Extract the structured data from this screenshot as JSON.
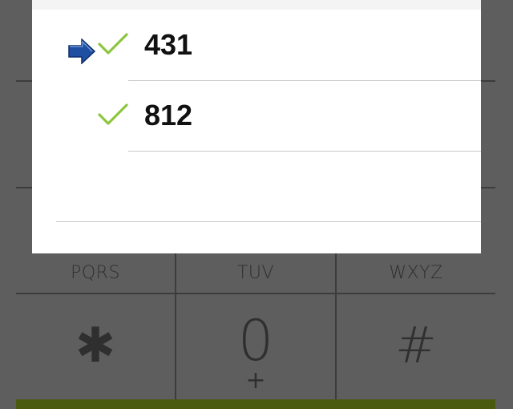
{
  "dialog": {
    "rows": [
      {
        "number": "431",
        "selected": true,
        "checked": true
      },
      {
        "number": "812",
        "selected": false,
        "checked": true
      }
    ]
  },
  "keypad": {
    "keys": [
      {
        "letters": "PQRS"
      },
      {
        "letters": "TUV"
      },
      {
        "letters": "WXYZ"
      },
      {
        "symbol": "✱"
      },
      {
        "digit": "0",
        "sub": "+"
      },
      {
        "symbol": "#"
      }
    ]
  },
  "icons": {
    "arrow": "arrow-right-icon",
    "check": "checkmark-icon"
  },
  "colors": {
    "check": "#8cc63f",
    "arrow": "#1f4fa0",
    "bottom_bar": "#4a5a0e"
  }
}
